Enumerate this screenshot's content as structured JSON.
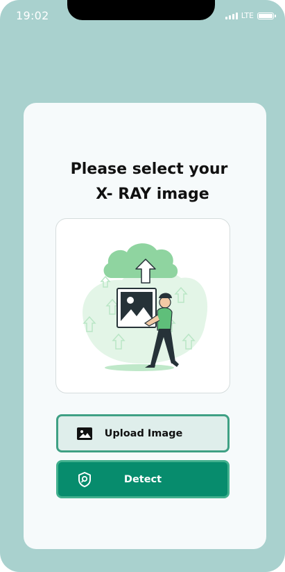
{
  "status_bar": {
    "time": "19:02",
    "network": "LTE"
  },
  "main": {
    "title_line1": "Please select your",
    "title_line2": "X- RAY image",
    "illustration_icon": "cloud-upload-illustration"
  },
  "buttons": {
    "upload_label": "Upload Image",
    "upload_icon": "image-icon",
    "detect_label": "Detect",
    "detect_icon": "shield-search-icon"
  },
  "colors": {
    "background": "#a9d1ce",
    "card": "#f6fafb",
    "accent_green": "#078c6d",
    "upload_fill": "#dfeeeb",
    "upload_border": "#3fa084"
  }
}
